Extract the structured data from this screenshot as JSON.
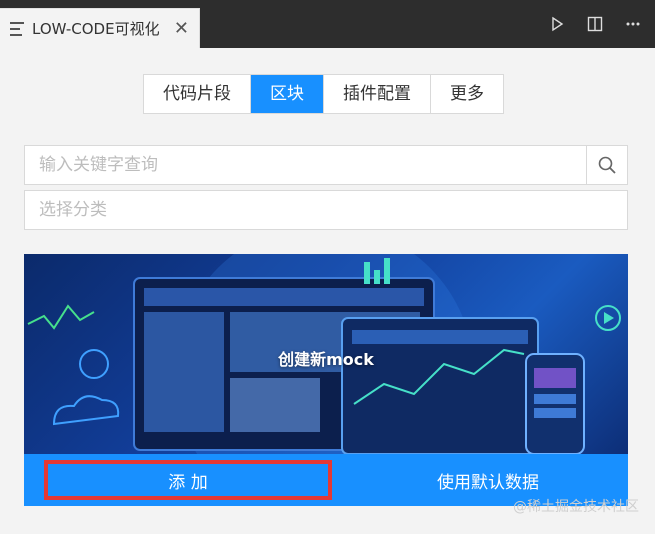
{
  "editor_tab": {
    "title": "LOW-CODE可视化",
    "close": "✕"
  },
  "segments": [
    {
      "label": "代码片段",
      "active": false
    },
    {
      "label": "区块",
      "active": true
    },
    {
      "label": "插件配置",
      "active": false
    },
    {
      "label": "更多",
      "active": false
    }
  ],
  "search": {
    "placeholder": "输入关键字查询"
  },
  "category_select": {
    "placeholder": "选择分类"
  },
  "card": {
    "title": "创建新mock",
    "add_label": "添 加",
    "default_label": "使用默认数据"
  },
  "watermark": "@稀土掘金技术社区",
  "colors": {
    "accent": "#1890ff",
    "highlight": "#e53935",
    "tabbar": "#2d2d2d"
  }
}
